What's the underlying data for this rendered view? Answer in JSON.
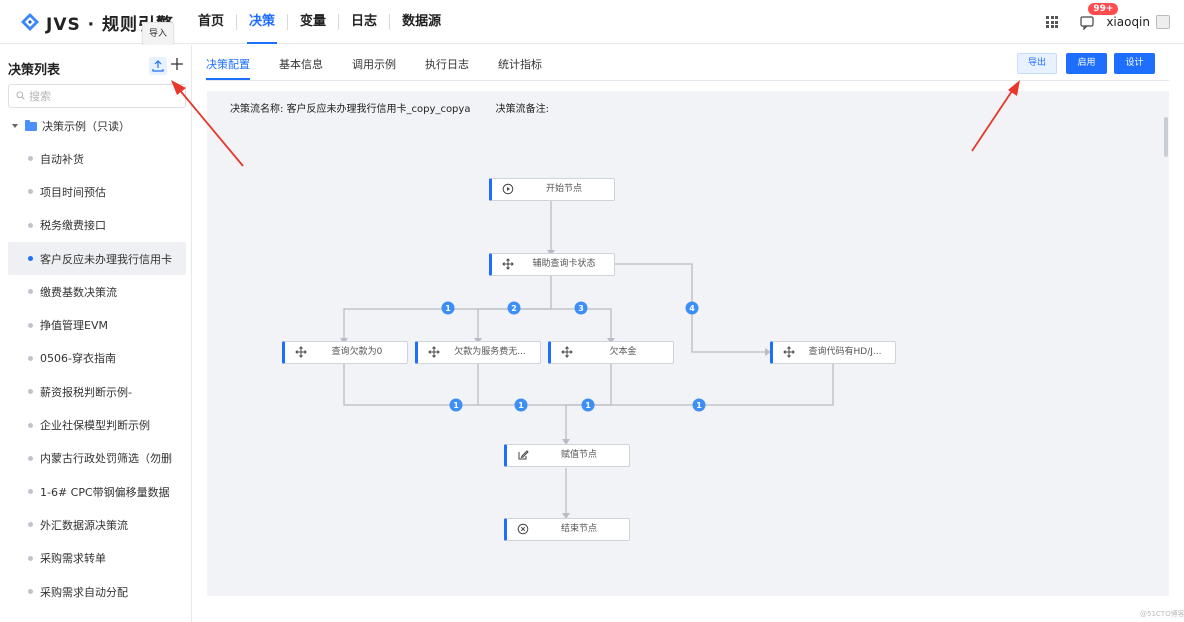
{
  "app": {
    "brand": "JVS · 规则引擎"
  },
  "nav": {
    "items": [
      {
        "label": "首页",
        "active": false
      },
      {
        "label": "决策",
        "active": true
      },
      {
        "label": "变量",
        "active": false
      },
      {
        "label": "日志",
        "active": false
      },
      {
        "label": "数据源",
        "active": false
      }
    ]
  },
  "topright": {
    "message_badge": "99+",
    "username": "xiaoqin"
  },
  "tooltip": {
    "text": "导入"
  },
  "sidebar": {
    "title": "决策列表",
    "search_placeholder": "搜索",
    "root_label": "决策示例（只读）",
    "items": [
      {
        "label": "自动补货",
        "active": false
      },
      {
        "label": "项目时间预估",
        "active": false
      },
      {
        "label": "税务缴费接口",
        "active": false
      },
      {
        "label": "客户反应未办理我行信用卡",
        "active": true
      },
      {
        "label": "缴费基数决策流",
        "active": false
      },
      {
        "label": "挣值管理EVM",
        "active": false
      },
      {
        "label": "0506-穿衣指南",
        "active": false
      },
      {
        "label": "薪资报税判断示例-",
        "active": false
      },
      {
        "label": "企业社保模型判断示例",
        "active": false
      },
      {
        "label": "内蒙古行政处罚筛选（勿删",
        "active": false
      },
      {
        "label": "1-6# CPC带钢偏移量数据",
        "active": false
      },
      {
        "label": "外汇数据源决策流",
        "active": false
      },
      {
        "label": "采购需求转单",
        "active": false
      },
      {
        "label": "采购需求自动分配",
        "active": false
      }
    ]
  },
  "tabs": [
    "决策配置",
    "基本信息",
    "调用示例",
    "执行日志",
    "统计指标"
  ],
  "actions": {
    "export": "导出",
    "enable": "启用",
    "design": "设计"
  },
  "flow": {
    "name_label": "决策流名称:",
    "name_value": "客户反应未办理我行信用卡_copy_copya",
    "remark_label": "决策流备注:",
    "nodes": {
      "start": "开始节点",
      "aux": "辅助查询卡状态",
      "q1": "查询欠款为0",
      "q2": "欠款为服务费无...",
      "q3": "欠本金",
      "q4": "查询代码有HD/J...",
      "assign": "赋值节点",
      "end": "结束节点"
    },
    "branch_badges": [
      "1",
      "2",
      "3",
      "4"
    ],
    "merge_badges": [
      "1",
      "1",
      "1",
      "1"
    ]
  },
  "watermark": "@51CTO博客",
  "colors": {
    "accent": "#1e6fff",
    "arrow": "#e8372b",
    "badge": "#3d8ff5",
    "line": "#b9bcc2"
  }
}
